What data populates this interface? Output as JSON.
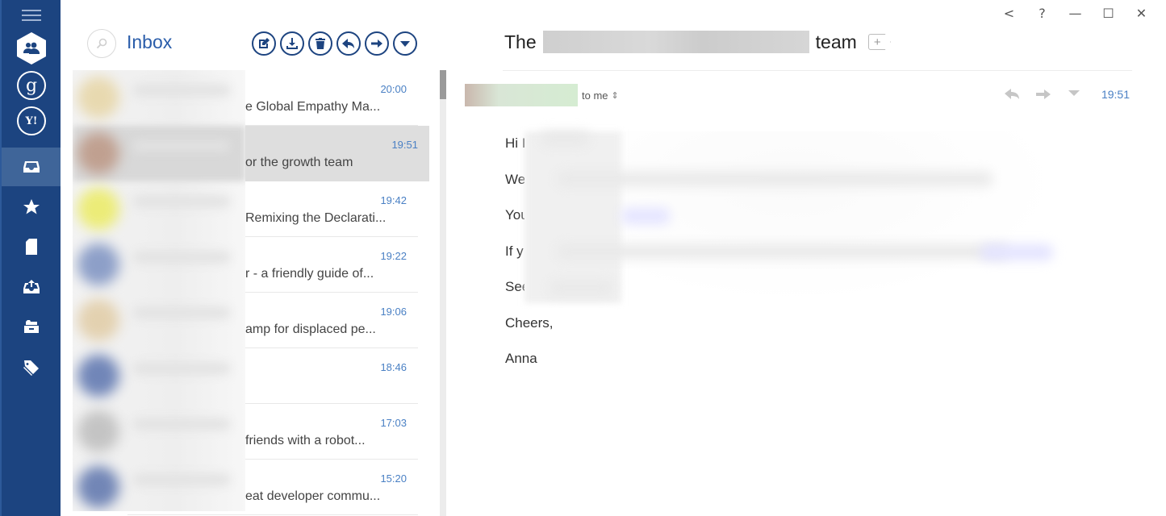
{
  "app": {
    "accounts": [
      {
        "name": "people-account",
        "icon": "people-icon"
      },
      {
        "name": "google-account",
        "icon": "google-icon",
        "glyph": "g"
      },
      {
        "name": "yahoo-account",
        "icon": "yahoo-icon",
        "glyph": "Y!"
      }
    ],
    "nav": [
      {
        "name": "inbox",
        "icon": "inbox-icon",
        "active": true
      },
      {
        "name": "starred",
        "icon": "star-icon",
        "active": false
      },
      {
        "name": "drafts",
        "icon": "draft-icon",
        "active": false
      },
      {
        "name": "sent",
        "icon": "outbox-icon",
        "active": false
      },
      {
        "name": "archive",
        "icon": "archive-icon",
        "active": false
      },
      {
        "name": "labels",
        "icon": "tags-icon",
        "active": false
      }
    ],
    "accent_color": "#1c4480",
    "time_color": "#4a80c4"
  },
  "list": {
    "title": "Inbox",
    "toolbar": [
      "compose",
      "download",
      "delete",
      "reply",
      "forward",
      "more"
    ],
    "messages": [
      {
        "time": "20:00",
        "subject": "e Global Empathy Ma...",
        "selected": false,
        "avatar": "#e8d9b0"
      },
      {
        "time": "19:51",
        "subject": "or the growth team",
        "selected": true,
        "avatar": "#c0a090"
      },
      {
        "time": "19:42",
        "subject": "Remixing the Declarati...",
        "selected": false,
        "avatar": "#ecec78"
      },
      {
        "time": "19:22",
        "subject": "r - a friendly guide of...",
        "selected": false,
        "avatar": "#8d9fc8"
      },
      {
        "time": "19:06",
        "subject": "amp for displaced pe...",
        "selected": false,
        "avatar": "#e3d1b0"
      },
      {
        "time": "18:46",
        "subject": "",
        "selected": false,
        "avatar": "#7186b8"
      },
      {
        "time": "17:03",
        "subject": " friends with a robot...",
        "selected": false,
        "avatar": "#c4c4c4"
      },
      {
        "time": "15:20",
        "subject": "eat developer commu...",
        "selected": false,
        "avatar": "#7286b6"
      }
    ]
  },
  "reading": {
    "window_controls": [
      "<",
      "?",
      "—",
      "☐",
      "✕"
    ],
    "subject_prefix": "The",
    "subject_suffix": "team",
    "to_label": "to me",
    "to_chevron": "⇕",
    "time": "19:51",
    "body_lines": [
      "Hi I",
      "We",
      "You",
      "If y",
      "See",
      "Cheers,",
      "Anna"
    ]
  }
}
